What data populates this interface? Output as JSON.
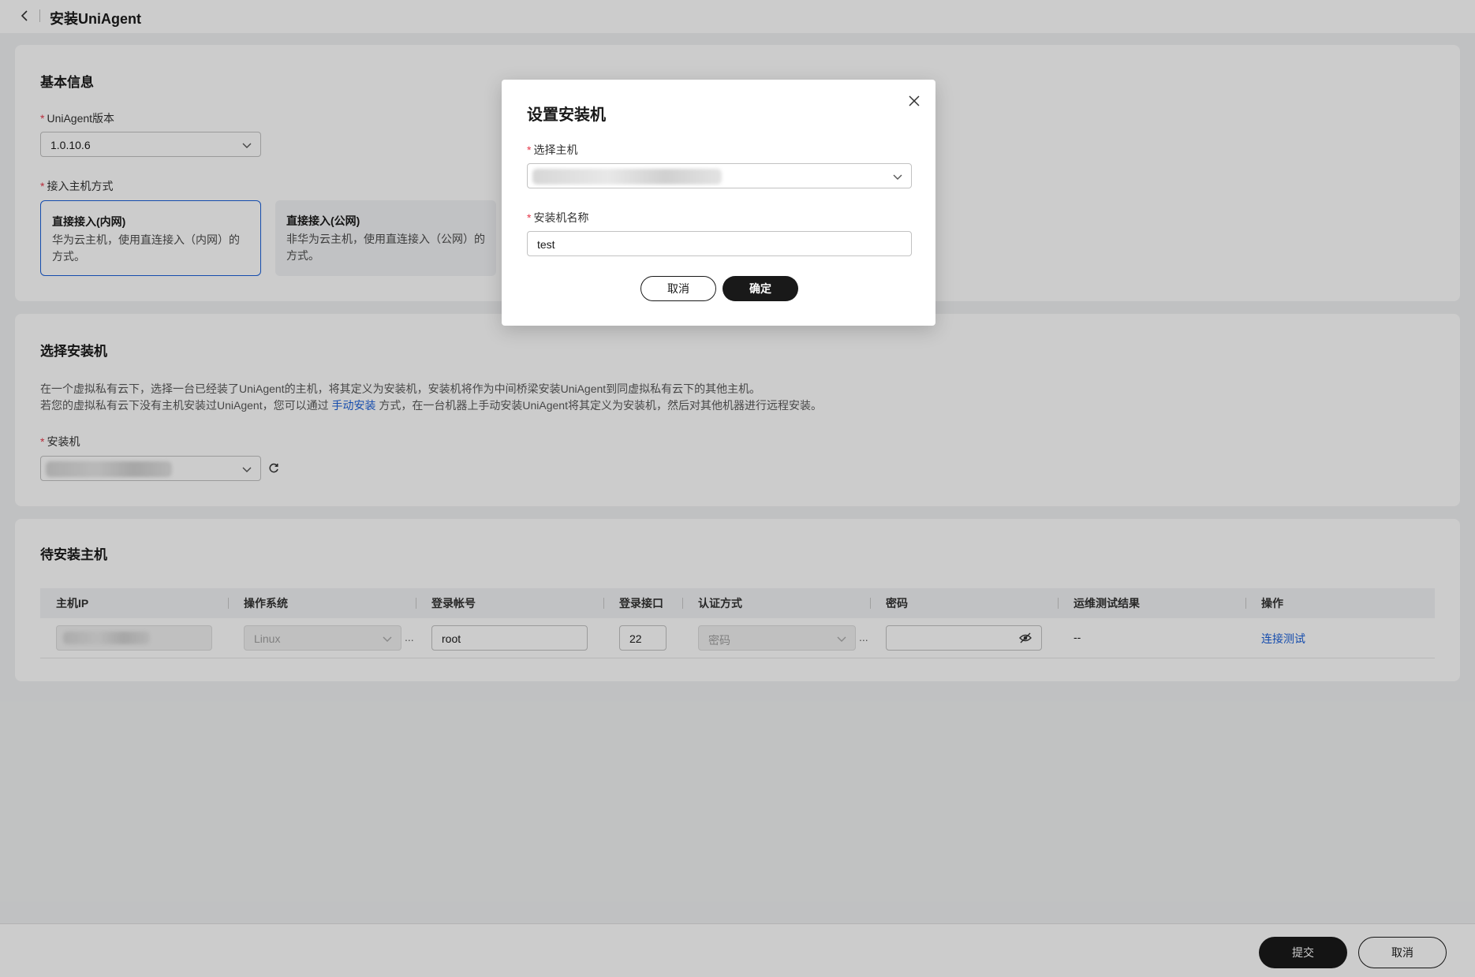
{
  "header": {
    "title": "安装UniAgent"
  },
  "basic_info": {
    "title": "基本信息",
    "version_label": "UniAgent版本",
    "version_value": "1.0.10.6",
    "access_label": "接入主机方式",
    "modes": [
      {
        "title": "直接接入(内网)",
        "desc": "华为云主机，使用直连接入（内网）的方式。"
      },
      {
        "title": "直接接入(公网)",
        "desc": "非华为云主机，使用直连接入（公网）的方式。"
      }
    ]
  },
  "installer": {
    "title": "选择安装机",
    "desc_line1": "在一个虚拟私有云下，选择一台已经装了UniAgent的主机，将其定义为安装机，安装机将作为中间桥梁安装UniAgent到同虚拟私有云下的其他主机。",
    "desc_line2_prefix": "若您的虚拟私有云下没有主机安装过UniAgent，您可以通过 ",
    "desc_line2_link": "手动安装",
    "desc_line2_suffix": " 方式，在一台机器上手动安装UniAgent将其定义为安装机，然后对其他机器进行远程安装。",
    "field_label": "安装机"
  },
  "hosts": {
    "title": "待安装主机",
    "columns": [
      "主机IP",
      "操作系统",
      "登录帐号",
      "登录接口",
      "认证方式",
      "密码",
      "运维测试结果",
      "操作"
    ],
    "rows": [
      {
        "os": "Linux",
        "account": "root",
        "port": "22",
        "auth": "密码",
        "test_result": "--",
        "action": "连接测试"
      }
    ],
    "ellipsis": "..."
  },
  "footer": {
    "submit": "提交",
    "cancel": "取消"
  },
  "modal": {
    "title": "设置安装机",
    "host_label": "选择主机",
    "name_label": "安装机名称",
    "name_value": "test",
    "cancel": "取消",
    "confirm": "确定"
  },
  "icons": [
    "back-icon",
    "chevron-down-icon",
    "refresh-icon",
    "eye-off-icon",
    "close-icon"
  ],
  "colors": {
    "primary": "#191919",
    "link": "#1a5fd9",
    "required": "#e5384a",
    "selected_border": "#1a5fd9"
  }
}
